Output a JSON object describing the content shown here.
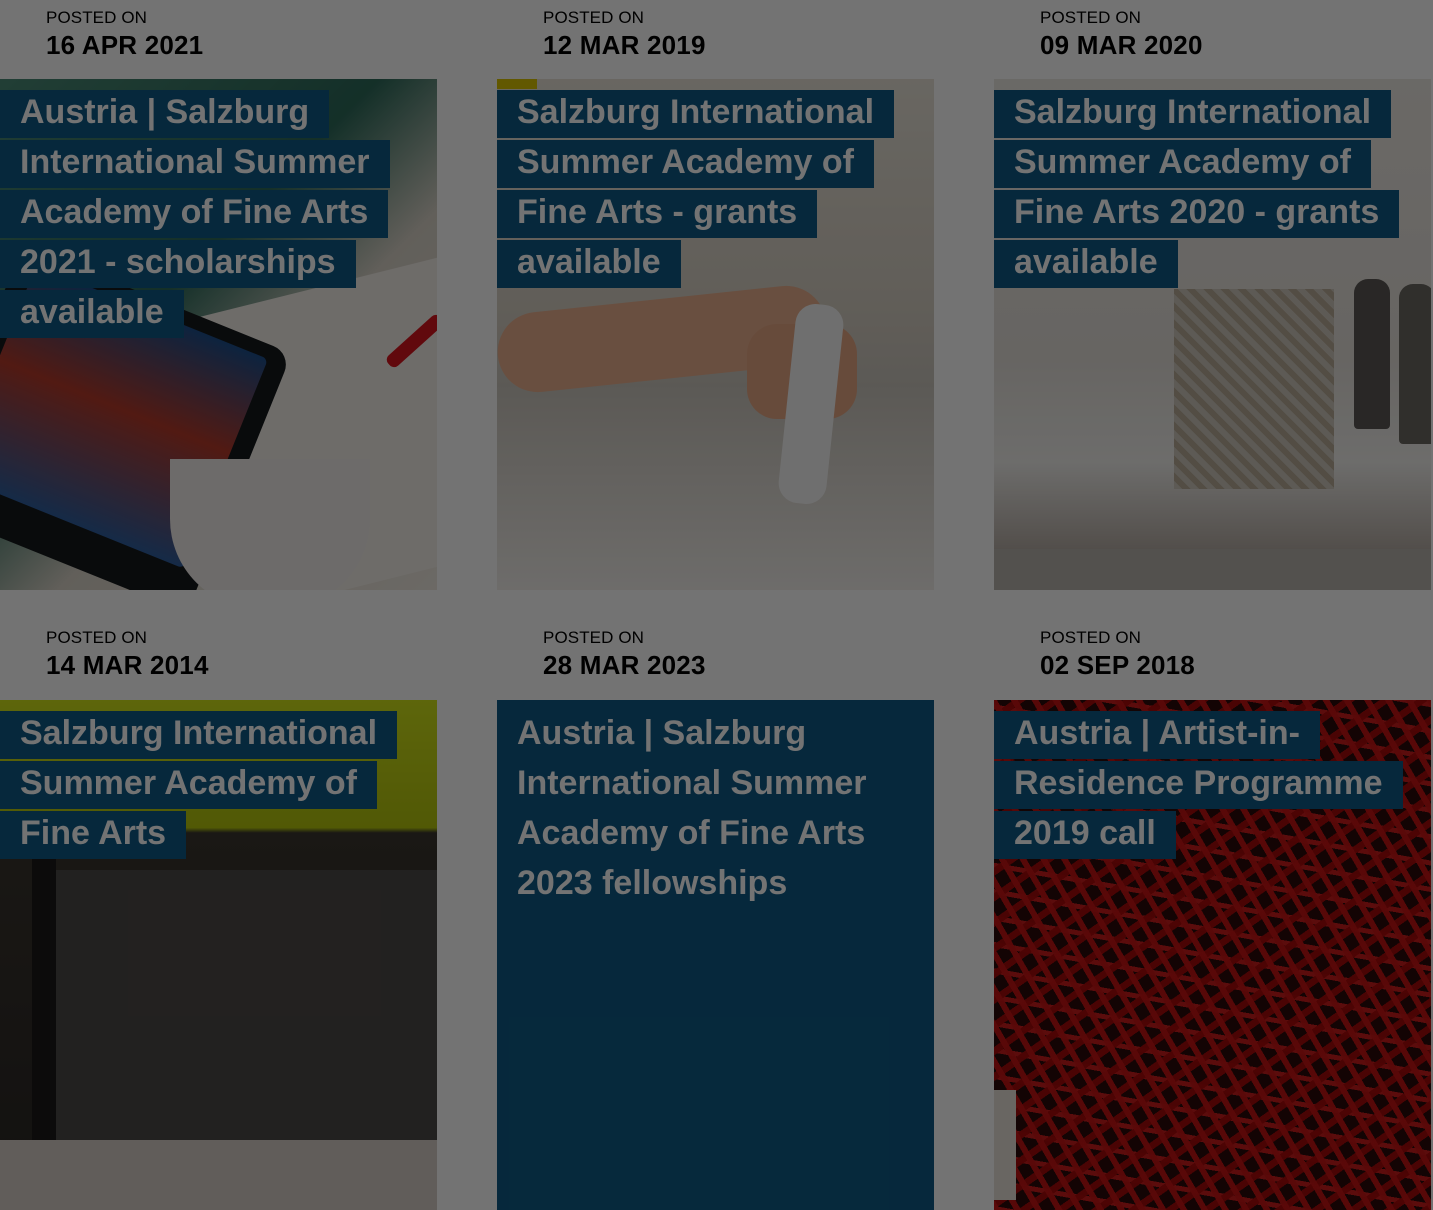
{
  "posts": [
    {
      "posted_label": "POSTED ON",
      "date": "16 APR 2021",
      "title": "Austria | Salzburg International Summer Academy of Fine Arts 2021 - scholarships available"
    },
    {
      "posted_label": "POSTED ON",
      "date": "12 MAR 2019",
      "title": "Salzburg International Summer Academy of Fine Arts - grants available"
    },
    {
      "posted_label": "POSTED ON",
      "date": "09 MAR 2020",
      "title": "Salzburg International Summer Academy of Fine Arts 2020 - grants available"
    },
    {
      "posted_label": "POSTED ON",
      "date": "14 MAR 2014",
      "title": "Salzburg International Summer Academy of Fine Arts"
    },
    {
      "posted_label": "POSTED ON",
      "date": "28 MAR 2023",
      "title": "Austria | Salzburg International Summer Academy of Fine Arts 2023 fellowships"
    },
    {
      "posted_label": "POSTED ON",
      "date": "02 SEP 2018",
      "title": "Austria | Artist-in-Residence Programme 2019 call"
    }
  ],
  "colors": {
    "title_background": "#0e5a86",
    "overlay": "rgba(0,0,0,0.55)"
  }
}
